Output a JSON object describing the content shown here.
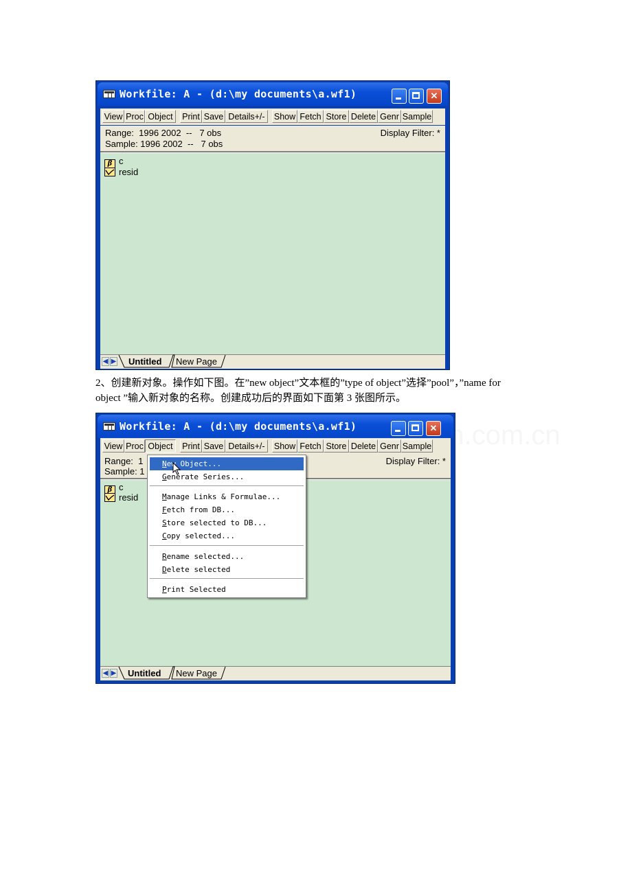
{
  "window1": {
    "title": "Workfile: A - (d:\\my documents\\a.wf1)",
    "toolbar": [
      "View",
      "Proc",
      "Object",
      "Print",
      "Save",
      "Details+/-",
      "Show",
      "Fetch",
      "Store",
      "Delete",
      "Genr",
      "Sample"
    ],
    "range": "Range:  1996 2002  --   7 obs",
    "sample": "Sample: 1996 2002  --   7 obs",
    "display_filter": "Display Filter: *",
    "objects": [
      {
        "name": "c",
        "icon": "coefficient-icon"
      },
      {
        "name": "resid",
        "icon": "series-icon"
      }
    ],
    "tabs": [
      "Untitled",
      "New Page"
    ]
  },
  "paragraph": {
    "line1": "2、创建新对象。操作如下图。在”new object”文本框的”type of object”选择”pool”，”name for",
    "line2": "object ”输入新对象的名称。创建成功后的界面如下面第 3 张图所示。"
  },
  "window2": {
    "title": "Workfile: A - (d:\\my documents\\a.wf1)",
    "toolbar": [
      "View",
      "Proc",
      "Object",
      "Print",
      "Save",
      "Details+/-",
      "Show",
      "Fetch",
      "Store",
      "Delete",
      "Genr",
      "Sample"
    ],
    "range": "Range:  1",
    "sample": "Sample: 1",
    "display_filter": "Display Filter: *",
    "objects": [
      {
        "name": "c",
        "icon": "coefficient-icon"
      },
      {
        "name": "resid",
        "icon": "series-icon"
      }
    ],
    "tabs": [
      "Untitled",
      "New Page"
    ],
    "menu": {
      "items": [
        {
          "key": "N",
          "rest": "ew Object...",
          "highlighted": true
        },
        {
          "key": "G",
          "rest": "enerate Series..."
        },
        {
          "key": "M",
          "rest": "anage Links & Formulae..."
        },
        {
          "key": "F",
          "rest": "etch from DB..."
        },
        {
          "key": "S",
          "rest": "tore selected to DB..."
        },
        {
          "key": "C",
          "rest": "opy selected..."
        },
        {
          "key": "R",
          "rest": "ename selected..."
        },
        {
          "key": "D",
          "rest": "elete selected"
        },
        {
          "key": "P",
          "rest": "rint Selected"
        }
      ]
    }
  },
  "colors": {
    "titlebar": "#0a4fd8",
    "list_background": "#cce6cf",
    "menu_highlight": "#316ac5",
    "close_button": "#c23a1c"
  }
}
